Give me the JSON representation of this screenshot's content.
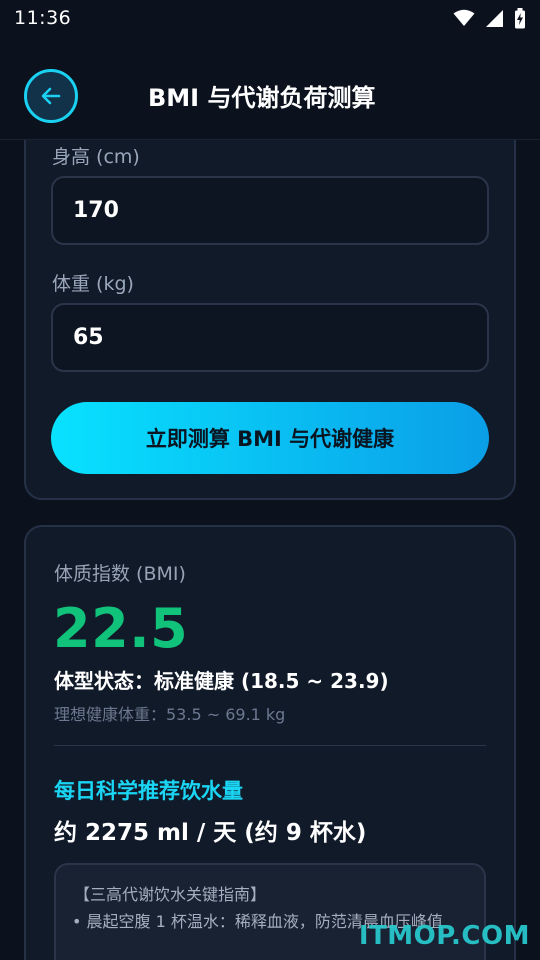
{
  "status_bar": {
    "time": "11:36",
    "icons": [
      "wifi-icon",
      "signal-icon",
      "battery-charging-icon"
    ]
  },
  "header": {
    "back_icon": "arrow-left-icon",
    "title": "BMI 与代谢负荷测算"
  },
  "form": {
    "height_label": "身高 (cm)",
    "height_value": "170",
    "weight_label": "体重 (kg)",
    "weight_value": "65",
    "submit_label": "立即测算 BMI 与代谢健康"
  },
  "result": {
    "bmi_label": "体质指数 (BMI)",
    "bmi_value": "22.5",
    "status": "体型状态：标准健康 (18.5 ~ 23.9)",
    "ideal_weight": "理想健康体重：53.5 ~ 69.1 kg",
    "water_title": "每日科学推荐饮水量",
    "water_amount": "约 2275 ml / 天 (约 9 杯水)",
    "guide_title": "【三高代谢饮水关键指南】",
    "guide_item_1": "• 晨起空腹 1 杯温水：稀释血液，防范清晨血压峰值"
  },
  "watermark": "ITMOP.COM",
  "colors": {
    "accent": "#1ad6f4",
    "bmi_green": "#10c27a",
    "background": "#0b111d",
    "card": "#111a29"
  }
}
